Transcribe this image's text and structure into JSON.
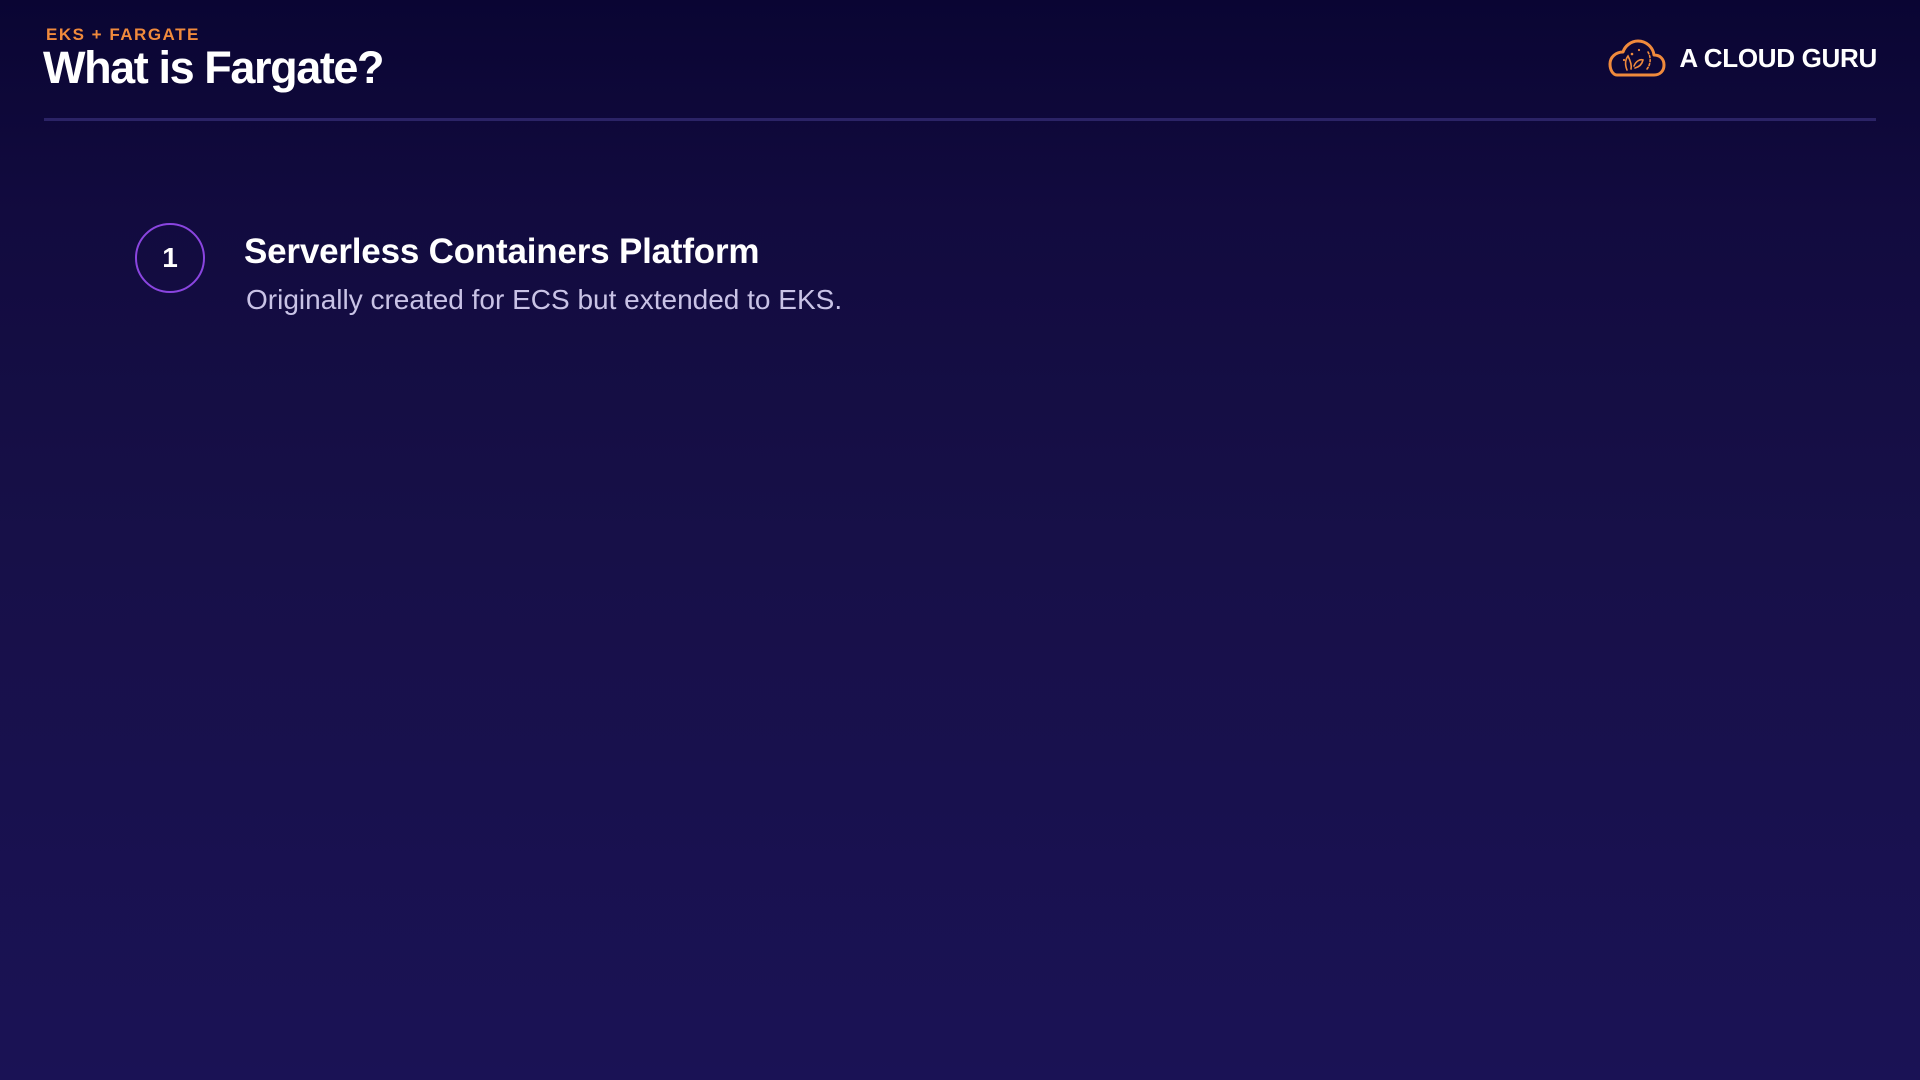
{
  "header": {
    "eyebrow": "EKS + FARGATE",
    "title": "What is Fargate?"
  },
  "brand": {
    "name": "A CLOUD GURU",
    "logo_icon": "cloud-logo-icon",
    "logo_color": "#f08a3c"
  },
  "points": [
    {
      "number": "1",
      "title": "Serverless Containers Platform",
      "description": "Originally created for ECS but extended to EKS."
    }
  ],
  "colors": {
    "accent_orange": "#f08a3c",
    "accent_purple": "#8a45e0",
    "background_top": "#0a0533",
    "background_bottom": "#1a1255",
    "text_primary": "#ffffff",
    "text_secondary": "#c9c3e6"
  }
}
